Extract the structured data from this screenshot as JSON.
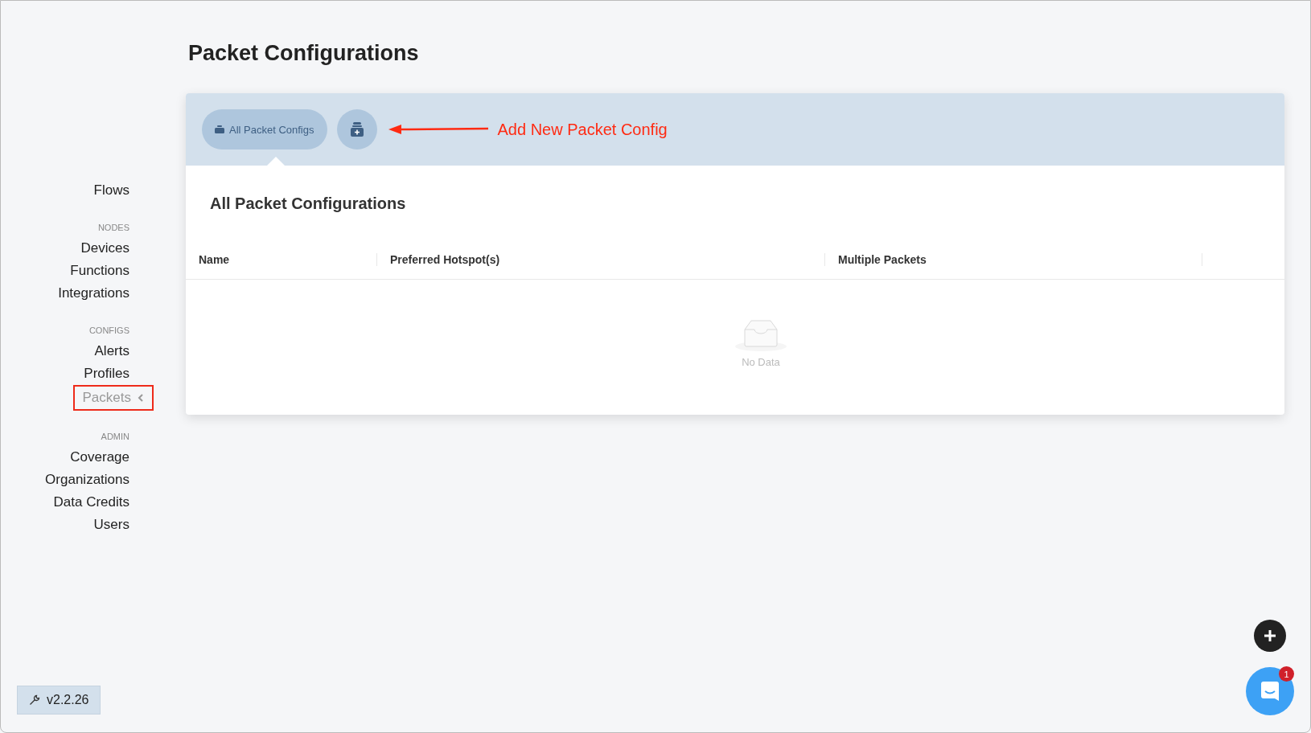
{
  "page_title": "Packet Configurations",
  "sidebar": {
    "sections": [
      {
        "items": [
          {
            "label": "Flows",
            "selected": false
          }
        ]
      },
      {
        "heading": "NODES",
        "items": [
          {
            "label": "Devices",
            "selected": false
          },
          {
            "label": "Functions",
            "selected": false
          },
          {
            "label": "Integrations",
            "selected": false
          }
        ]
      },
      {
        "heading": "CONFIGS",
        "items": [
          {
            "label": "Alerts",
            "selected": false
          },
          {
            "label": "Profiles",
            "selected": false
          },
          {
            "label": "Packets",
            "selected": true
          }
        ]
      },
      {
        "heading": "ADMIN",
        "items": [
          {
            "label": "Coverage",
            "selected": false
          },
          {
            "label": "Organizations",
            "selected": false
          },
          {
            "label": "Data Credits",
            "selected": false
          },
          {
            "label": "Users",
            "selected": false
          }
        ]
      }
    ]
  },
  "toolbar": {
    "tabs": [
      {
        "label": "All Packet Configs",
        "selected": true
      }
    ],
    "annotation": "Add New Packet Config"
  },
  "table": {
    "title": "All Packet Configurations",
    "columns": [
      "Name",
      "Preferred Hotspot(s)",
      "Multiple Packets"
    ],
    "empty_text": "No Data"
  },
  "version": "v2.2.26",
  "chat": {
    "badge": "1"
  }
}
